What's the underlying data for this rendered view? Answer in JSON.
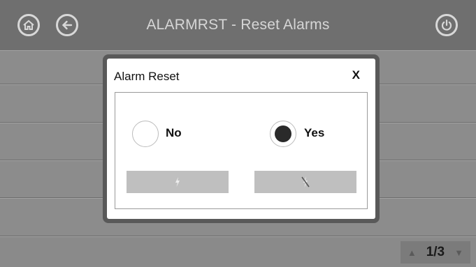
{
  "header": {
    "title": "ALARMRST - Reset Alarms",
    "home_icon": "home-icon",
    "back_icon": "back-arrow-icon",
    "power_icon": "power-icon"
  },
  "dialog": {
    "title": "Alarm Reset",
    "close_label": "X",
    "options": [
      {
        "label": "No",
        "selected": false
      },
      {
        "label": "Yes",
        "selected": true
      }
    ],
    "confirm_icon": "lightning-icon",
    "cancel_icon": "lightning-off-icon"
  },
  "pager": {
    "page": "1/3",
    "up_icon": "up-triangle-icon",
    "down_icon": "down-triangle-icon"
  },
  "colors": {
    "header_bg": "#6f6f6f",
    "content_bg": "#8c8c8c",
    "dialog_bg": "#ffffff",
    "button_bg": "#bfbfbf"
  }
}
